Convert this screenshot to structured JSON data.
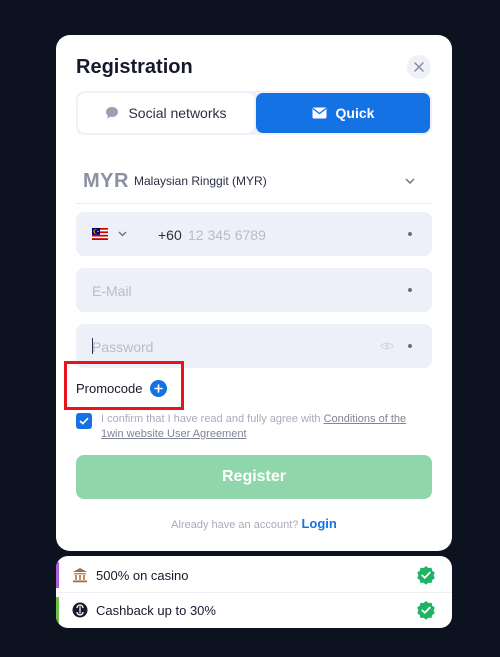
{
  "modal": {
    "title": "Registration",
    "tabs": [
      {
        "label": "Social networks",
        "icon": "chat-bubble-icon",
        "active": false
      },
      {
        "label": "Quick",
        "icon": "envelope-icon",
        "active": true
      }
    ]
  },
  "form": {
    "currency": {
      "code": "MYR",
      "name": "Malaysian Ringgit (MYR)"
    },
    "phone": {
      "country": "Malaysia",
      "prefix": "+60",
      "placeholder": "12 345 6789"
    },
    "email": {
      "placeholder": "E-Mail"
    },
    "password": {
      "placeholder": "Password"
    },
    "promocode_label": "Promocode",
    "agreement": {
      "checked": true,
      "text": "I confirm that I have read and fully agree with ",
      "link": "Conditions of the 1win website User Agreement"
    },
    "register_label": "Register",
    "login_prompt": "Already have an account?",
    "login_label": "Login"
  },
  "bonuses": [
    {
      "label": "500% on casino",
      "icon": "casino-building-icon",
      "accent": "#b05ed6"
    },
    {
      "label": "Cashback up to 30%",
      "icon": "cashback-icon",
      "accent": "#6cc04a"
    }
  ],
  "colors": {
    "accent": "#1472e5",
    "register": "#8fd7ab",
    "highlight": "#e5141e",
    "check_green": "#1fb463"
  }
}
